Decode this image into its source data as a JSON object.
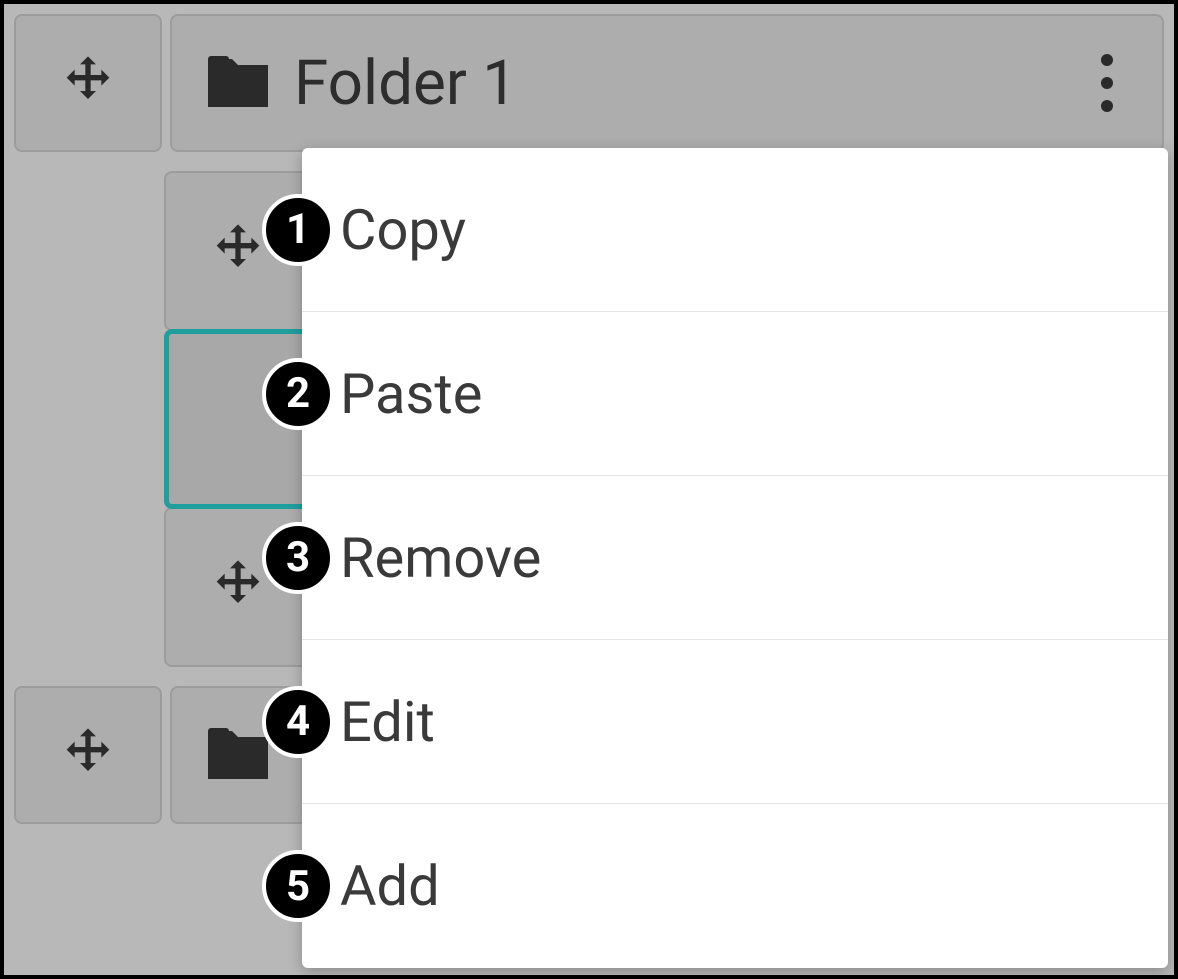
{
  "folders": {
    "top": {
      "label": "Folder 1"
    },
    "bottom": {
      "label": ""
    }
  },
  "menu": {
    "items": [
      {
        "num": "1",
        "label": "Copy"
      },
      {
        "num": "2",
        "label": "Paste"
      },
      {
        "num": "3",
        "label": "Remove"
      },
      {
        "num": "4",
        "label": "Edit"
      },
      {
        "num": "5",
        "label": "Add"
      }
    ]
  }
}
